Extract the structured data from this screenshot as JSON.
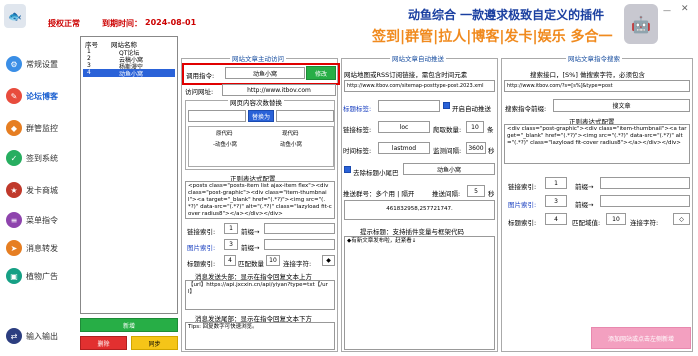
{
  "header": {
    "status_label": "授权正常",
    "expiry_label": "到期时间：",
    "expiry_date": "2024-08-01"
  },
  "banner": {
    "title": "动鱼综合 一款遵求极致自定义的插件",
    "tagline": "签到|群管|拉人|博客|发卡|娱乐 多合一"
  },
  "sidebar": {
    "items": [
      {
        "label": "常规设置",
        "icon": "gear-icon",
        "color": "#3a8ee6"
      },
      {
        "label": "论坛博客",
        "icon": "doc-icon",
        "color": "#e84c3d"
      },
      {
        "label": "群管监控",
        "icon": "shield-icon",
        "color": "#e67e22"
      },
      {
        "label": "签到系统",
        "icon": "check-icon",
        "color": "#27ae60"
      },
      {
        "label": "发卡商城",
        "icon": "cart-icon",
        "color": "#c0392b"
      },
      {
        "label": "菜单指令",
        "icon": "menu-icon",
        "color": "#8e44ad"
      },
      {
        "label": "消息转发",
        "icon": "forward-icon",
        "color": "#e67e22"
      },
      {
        "label": "植物广告",
        "icon": "ad-icon",
        "color": "#16a085"
      },
      {
        "label": "输入输出",
        "icon": "io-icon",
        "color": "#2c3e80"
      }
    ]
  },
  "list": {
    "headers": [
      "序号",
      "网站名称"
    ],
    "rows": [
      {
        "num": "1",
        "name": "QT论坛"
      },
      {
        "num": "2",
        "name": "云稿小窝"
      },
      {
        "num": "3",
        "name": "杨斯漫空"
      },
      {
        "num": "4",
        "name": "动鱼小窝"
      }
    ],
    "add_label": "新增",
    "delete_label": "删除",
    "sync_label": "同步"
  },
  "panel1": {
    "title": "网站文章主动访问",
    "cmd_label": "调用指令:",
    "cmd_value": "动鱼小窝",
    "modify_label": "修改",
    "url_label": "访问网址:",
    "url_value": "http://www.itbov.com",
    "replace_title": "网页内容次数替换",
    "replace_btn": "替换为",
    "orig_label": "原代码",
    "repl_label": "现代码",
    "orig_value": "-动鱼小窝",
    "repl_value": "动鱼小窝",
    "regex_title": "正则表达式配置",
    "regex_text": "<posts class=\"posts-item list ajax-item flex\"><div class=\"post-graphic\"><div class=\"item-thumbnail\"><a target=\"_blank\" href=\"(.*?)\"><img src=\"(.*?)\" data-src=\"(.*?)\" alt=\"(.*?)\" class=\"lazyload fit-cover radius8\"></a></div></div>",
    "link_label": "链接索引:",
    "link_val": "1",
    "prev_label": "前缀→",
    "img_label": "图片索引:",
    "img_val": "3",
    "prev2_label": "前缀→",
    "title_label": "标题索引:",
    "title_val": "4",
    "match_label": "匹配数量",
    "match_val": "10",
    "conn_label": "连接字符:",
    "conn_val": "◆",
    "header_note": "消息发送头部：显示在指令回复文本上方",
    "header_text": "【url】https://api.jxcxin.cn/api/yiyan?type=txt【/url】",
    "footer_note": "消息发送尾部：显示在指令回复文本下方",
    "footer_text": "Tips: 回复数字可快速浏览。"
  },
  "panel2": {
    "title": "网站文章自动推送",
    "desc": "网站地图或RSS订阅链接，需包含时间元素",
    "url_value": "http://www.itbov.com/sitemap-posttype-post.2023.xml",
    "tag_label": "标题标签:",
    "enable_label": "开启自动推送",
    "link_label": "链接标签:",
    "link_value": "loc",
    "crawl_label": "爬取数量:",
    "crawl_val": "10",
    "crawl_unit": "条",
    "time_label": "时间标签:",
    "time_value": "lastmod",
    "interval_label": "监测间隔:",
    "interval_val": "3600",
    "interval_unit": "秒",
    "strip_label": "去除标题小尾巴",
    "strip_value": "动鱼小窝",
    "group_label": "推送群号：多个用 | 隔开",
    "push_interval_label": "推送间隔:",
    "push_interval_val": "5",
    "push_unit": "秒",
    "groups": "461832958,257721747.",
    "tip": "提示标题：支持插件变量与框架代码",
    "tip_text": "◆有新文章发布啦，赶紧看↓"
  },
  "panel3": {
    "title": "网站文章指令搜索",
    "search_desc": "搜索接口，[S%] 做搜索字符，必须包含",
    "search_url": "http://www.itbov.com/?s=[s%]&type=post",
    "prefix_label": "搜索指令前缀:",
    "prefix_value": "搜文章",
    "regex_title": "正则表达式配置",
    "regex_text": "<div class=\"post-graphic\"><div class=\"item-thumbnail\"><a target=\"_blank\" href=\"(.*?)\"><img src=\"(.*?)\" data-src=\"(.*?)\" alt=\"(.*?)\" class=\"lazyload fit-cover radius8\"></a></div></div>",
    "link_label": "链接索引:",
    "link_val": "1",
    "prev_label": "前缀→",
    "img_label": "图片索引:",
    "img_val": "3",
    "prev2_label": "前缀→",
    "title_label": "标题索引:",
    "title_val": "4",
    "match_label": "匹配域值:",
    "match_val": "10",
    "conn_label": "连接字符:",
    "conn_val": "◇",
    "sync_btn": "添加网站或点击左侧新增"
  }
}
